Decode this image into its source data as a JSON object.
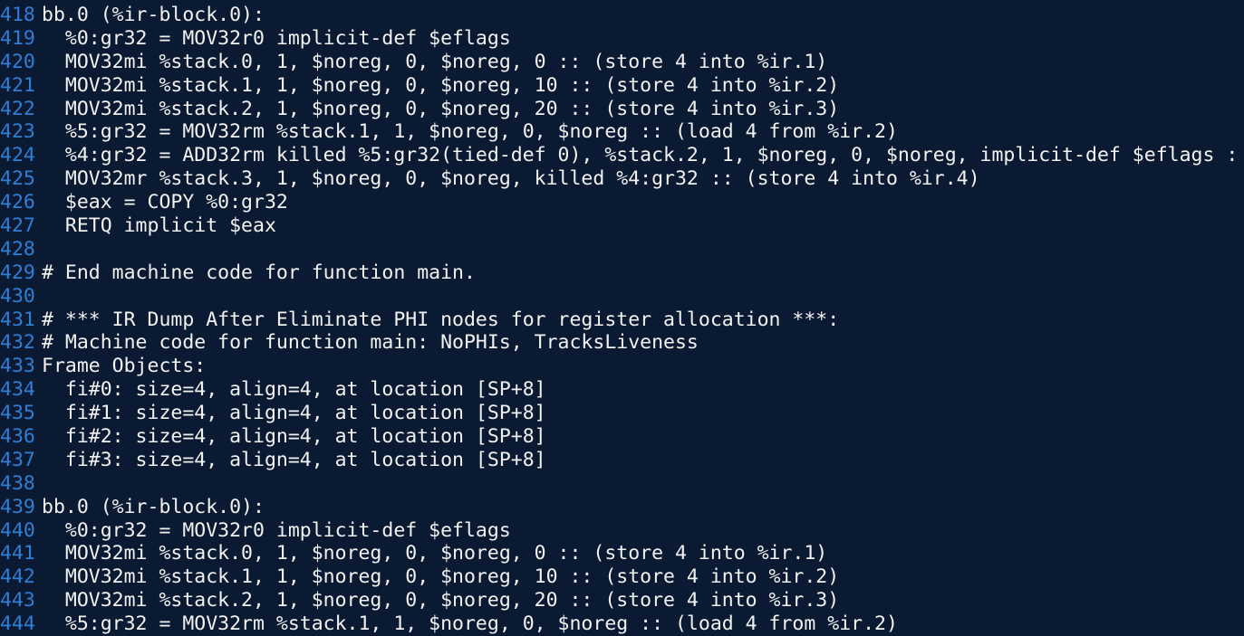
{
  "editor": {
    "lines": [
      {
        "num": "418",
        "text": "bb.0 (%ir-block.0):"
      },
      {
        "num": "419",
        "text": "  %0:gr32 = MOV32r0 implicit-def $eflags"
      },
      {
        "num": "420",
        "text": "  MOV32mi %stack.0, 1, $noreg, 0, $noreg, 0 :: (store 4 into %ir.1)"
      },
      {
        "num": "421",
        "text": "  MOV32mi %stack.1, 1, $noreg, 0, $noreg, 10 :: (store 4 into %ir.2)"
      },
      {
        "num": "422",
        "text": "  MOV32mi %stack.2, 1, $noreg, 0, $noreg, 20 :: (store 4 into %ir.3)"
      },
      {
        "num": "423",
        "text": "  %5:gr32 = MOV32rm %stack.1, 1, $noreg, 0, $noreg :: (load 4 from %ir.2)"
      },
      {
        "num": "424",
        "text": "  %4:gr32 = ADD32rm killed %5:gr32(tied-def 0), %stack.2, 1, $noreg, 0, $noreg, implicit-def $eflags :"
      },
      {
        "num": "425",
        "text": "  MOV32mr %stack.3, 1, $noreg, 0, $noreg, killed %4:gr32 :: (store 4 into %ir.4)"
      },
      {
        "num": "426",
        "text": "  $eax = COPY %0:gr32"
      },
      {
        "num": "427",
        "text": "  RETQ implicit $eax"
      },
      {
        "num": "428",
        "text": ""
      },
      {
        "num": "429",
        "text": "# End machine code for function main."
      },
      {
        "num": "430",
        "text": ""
      },
      {
        "num": "431",
        "text": "# *** IR Dump After Eliminate PHI nodes for register allocation ***:"
      },
      {
        "num": "432",
        "text": "# Machine code for function main: NoPHIs, TracksLiveness"
      },
      {
        "num": "433",
        "text": "Frame Objects:"
      },
      {
        "num": "434",
        "text": "  fi#0: size=4, align=4, at location [SP+8]"
      },
      {
        "num": "435",
        "text": "  fi#1: size=4, align=4, at location [SP+8]"
      },
      {
        "num": "436",
        "text": "  fi#2: size=4, align=4, at location [SP+8]"
      },
      {
        "num": "437",
        "text": "  fi#3: size=4, align=4, at location [SP+8]"
      },
      {
        "num": "438",
        "text": ""
      },
      {
        "num": "439",
        "text": "bb.0 (%ir-block.0):"
      },
      {
        "num": "440",
        "text": "  %0:gr32 = MOV32r0 implicit-def $eflags"
      },
      {
        "num": "441",
        "text": "  MOV32mi %stack.0, 1, $noreg, 0, $noreg, 0 :: (store 4 into %ir.1)"
      },
      {
        "num": "442",
        "text": "  MOV32mi %stack.1, 1, $noreg, 0, $noreg, 10 :: (store 4 into %ir.2)"
      },
      {
        "num": "443",
        "text": "  MOV32mi %stack.2, 1, $noreg, 0, $noreg, 20 :: (store 4 into %ir.3)"
      },
      {
        "num": "444",
        "text": "  %5:gr32 = MOV32rm %stack.1, 1, $noreg, 0, $noreg :: (load 4 from %ir.2)"
      }
    ]
  },
  "colors": {
    "background": "#0a1a33",
    "line_number": "#2f7fd6",
    "text": "#f2f2f2"
  }
}
